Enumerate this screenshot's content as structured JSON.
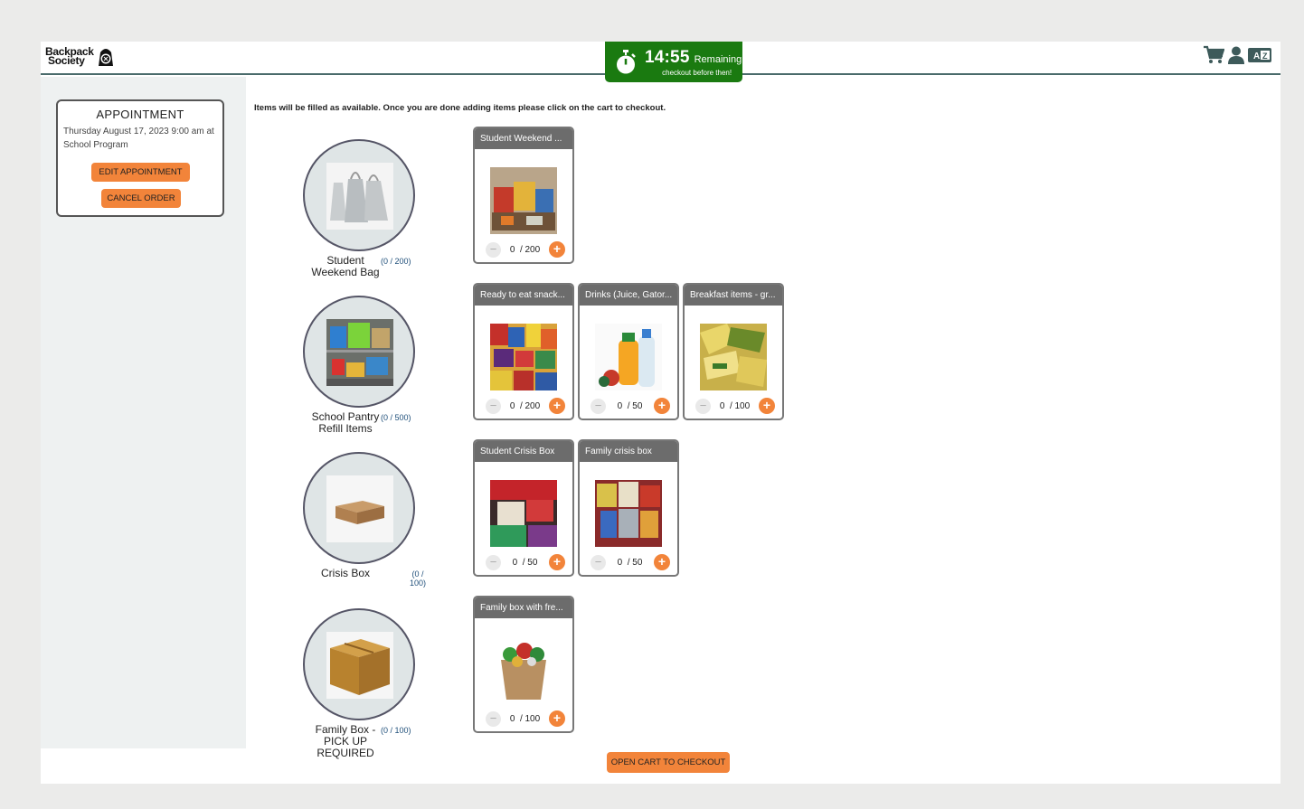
{
  "header": {
    "logo_line1": "Backpack",
    "logo_line2": "Society",
    "timer": {
      "time": "14:55",
      "remaining_label": "Remaining",
      "subtitle": "checkout before then!"
    },
    "icons": [
      "cart-icon",
      "user-icon",
      "translate-icon"
    ]
  },
  "appointment": {
    "title": "APPOINTMENT",
    "details": "Thursday August 17, 2023 9:00 am at School Program",
    "edit_label": "EDIT APPOINTMENT",
    "cancel_label": "CANCEL ORDER"
  },
  "instructions": "Items will be filled as available.  Once you are done adding items please click on the cart to checkout.",
  "categories": [
    {
      "label": "Student Weekend Bag",
      "count": "(0 / 200)"
    },
    {
      "label": "School Pantry Refill Items",
      "count": "(0 / 500)"
    },
    {
      "label": "Crisis Box",
      "count": "(0 / 100)"
    },
    {
      "label": "Family Box - PICK UP REQUIRED",
      "count": "(0 / 100)"
    }
  ],
  "items": [
    {
      "title": "Student Weekend ...",
      "qty": "0",
      "max": "200"
    },
    {
      "title": "Ready to eat snack...",
      "qty": "0",
      "max": "200"
    },
    {
      "title": "Drinks (Juice, Gator...",
      "qty": "0",
      "max": "50"
    },
    {
      "title": "Breakfast items - gr...",
      "qty": "0",
      "max": "100"
    },
    {
      "title": "Student Crisis Box",
      "qty": "0",
      "max": "50"
    },
    {
      "title": "Family crisis box",
      "qty": "0",
      "max": "50"
    },
    {
      "title": "Family box with fre...",
      "qty": "0",
      "max": "100"
    }
  ],
  "controls": {
    "minus": "−",
    "plus": "+",
    "sep": "/"
  },
  "checkout_label": "OPEN CART TO CHECKOUT",
  "colors": {
    "accent": "#f2843a",
    "timer_bg": "#1a7a10",
    "header_line": "#4a6b6b",
    "card_header": "#6c6c6c"
  }
}
